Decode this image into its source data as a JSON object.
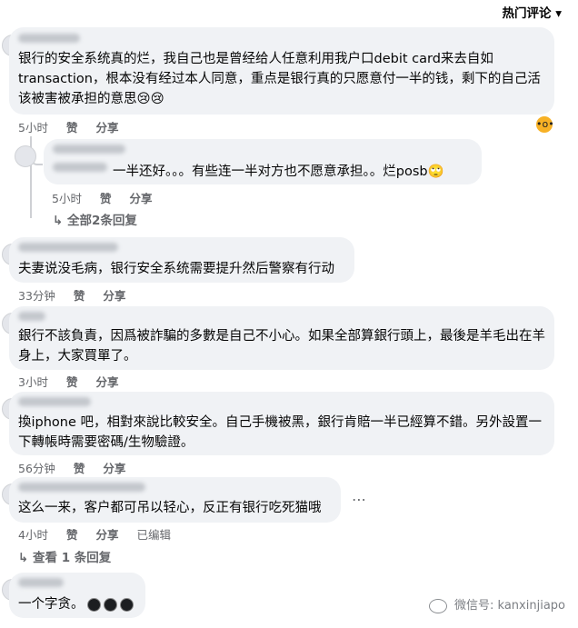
{
  "header": {
    "sort_label": "热门评论",
    "sort_icon": "chevron-down-icon"
  },
  "comments": [
    {
      "text": "银行的安全系统真的烂，我自己也是曾经给人任意利用我户口debit card来去自如transaction，根本没有经过本人同意，重点是银行真的只愿意付一半的钱，剩下的自己活该被害被承担的意思😢😢",
      "time": "5小时",
      "like": "赞",
      "share": "分享",
      "reaction_icon": "wow-reaction-icon"
    },
    {
      "text": "一半还好。。。有些连一半对方也不愿意承担。。烂posb🙄",
      "time": "5小时",
      "like": "赞",
      "share": "分享"
    },
    {
      "replies_label": "全部2条回复"
    },
    {
      "text": "夫妻说没毛病，银行安全系统需要提升然后警察有行动",
      "time": "33分钟",
      "like": "赞",
      "share": "分享"
    },
    {
      "text": "銀行不該負責，因爲被詐騙的多數是自己不小心。如果全部算銀行頭上，最後是羊毛出在羊身上，大家買單了。",
      "time": "3小时",
      "like": "赞",
      "share": "分享"
    },
    {
      "text": "換iphone 吧，相對來說比較安全。自己手機被黑，銀行肯賠一半已經算不錯。另外設置一下轉帳時需要密碼/生物驗證。",
      "time": "56分钟",
      "like": "赞",
      "share": "分享"
    },
    {
      "text": "这么一来，客户都可吊以轻心，反正有银行吃死猫哦",
      "time": "4小时",
      "like": "赞",
      "share": "分享",
      "edited": "已编辑"
    },
    {
      "replies_label": "查看 1 条回复"
    },
    {
      "text": "一个字贪。"
    }
  ],
  "watermark": {
    "label": "微信号: kanxinjiapo"
  },
  "colors": {
    "bubble": "#f0f2f5",
    "meta": "#65676b"
  }
}
